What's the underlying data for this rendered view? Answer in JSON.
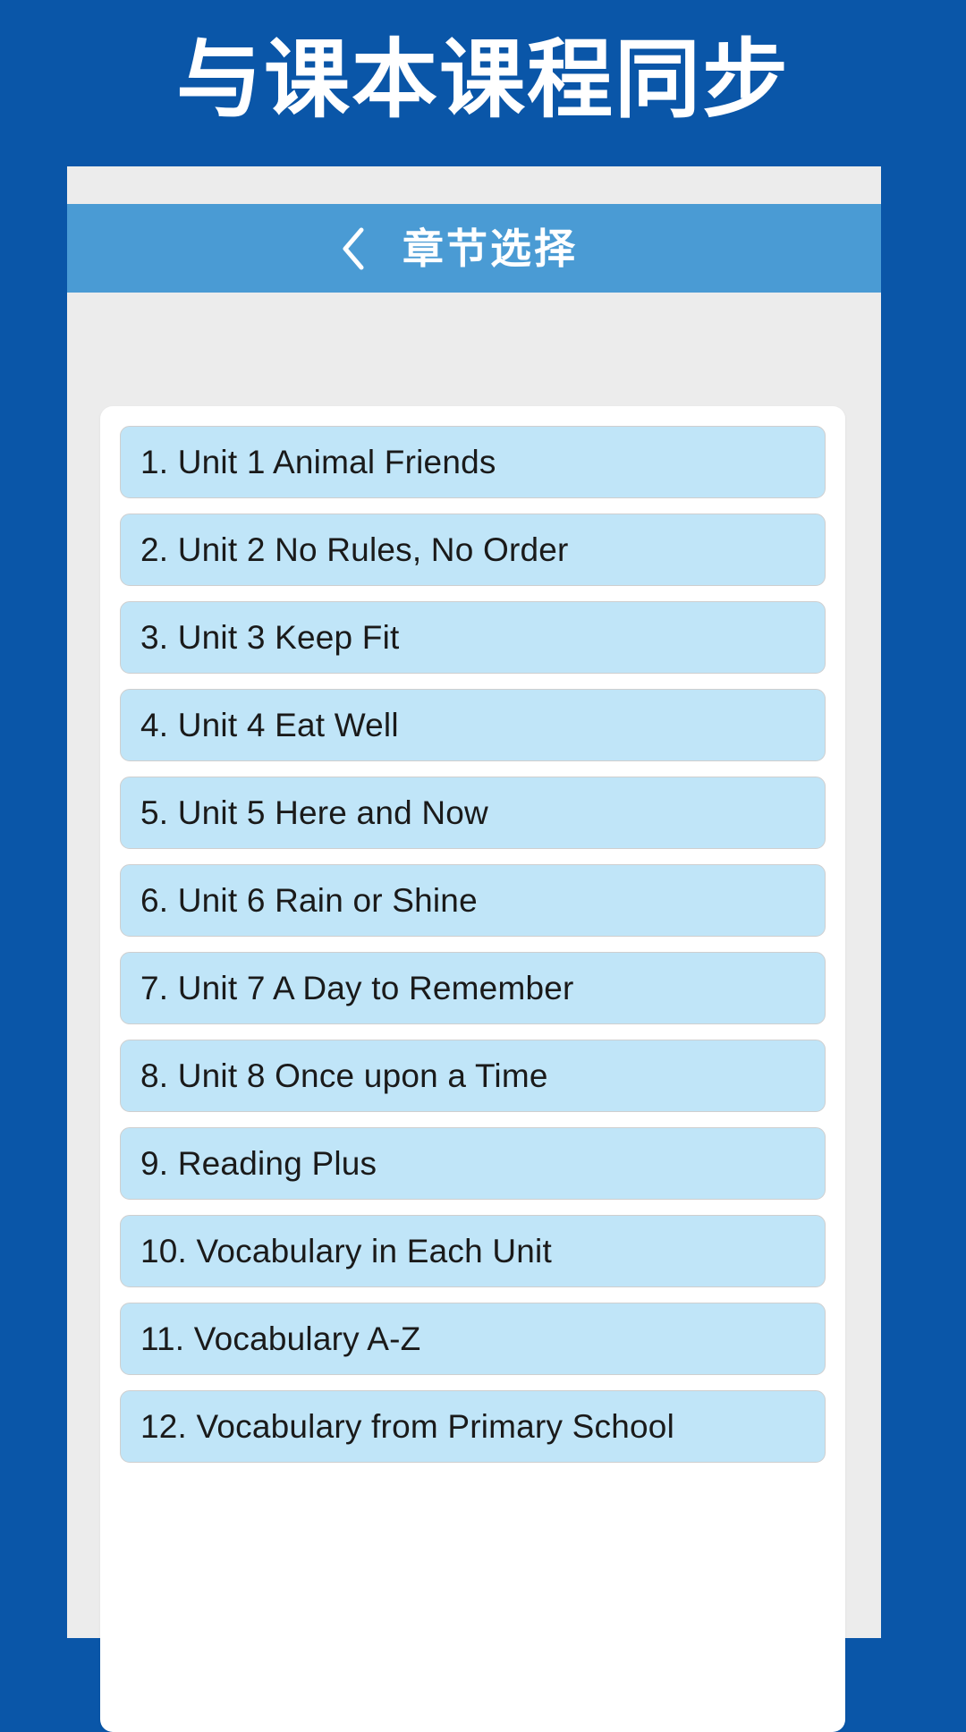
{
  "promo": {
    "headline": "与课本课程同步"
  },
  "app": {
    "navbar": {
      "back_icon": "chevron-left-icon",
      "title": "章节选择"
    },
    "chapters": [
      {
        "label": "1. Unit 1 Animal Friends"
      },
      {
        "label": "2. Unit 2 No Rules, No Order"
      },
      {
        "label": "3. Unit 3 Keep Fit"
      },
      {
        "label": "4. Unit 4 Eat Well"
      },
      {
        "label": "5. Unit 5 Here and Now"
      },
      {
        "label": "6. Unit 6 Rain or Shine"
      },
      {
        "label": "7. Unit 7 A Day to Remember"
      },
      {
        "label": "8. Unit 8 Once upon a Time"
      },
      {
        "label": "9. Reading Plus"
      },
      {
        "label": "10. Vocabulary in Each Unit"
      },
      {
        "label": "11. Vocabulary A-Z"
      },
      {
        "label": "12. Vocabulary from Primary School"
      }
    ]
  },
  "colors": {
    "promo_background": "#0A56A8",
    "navbar_background": "#4A9BD4",
    "shell_background": "#ECECEC",
    "card_background": "#FFFFFF",
    "chapter_pill": "#C0E5F8",
    "chapter_pill_border": "#CFCFCF",
    "text_primary": "#1A1A1A",
    "text_inverse": "#FFFFFF"
  }
}
